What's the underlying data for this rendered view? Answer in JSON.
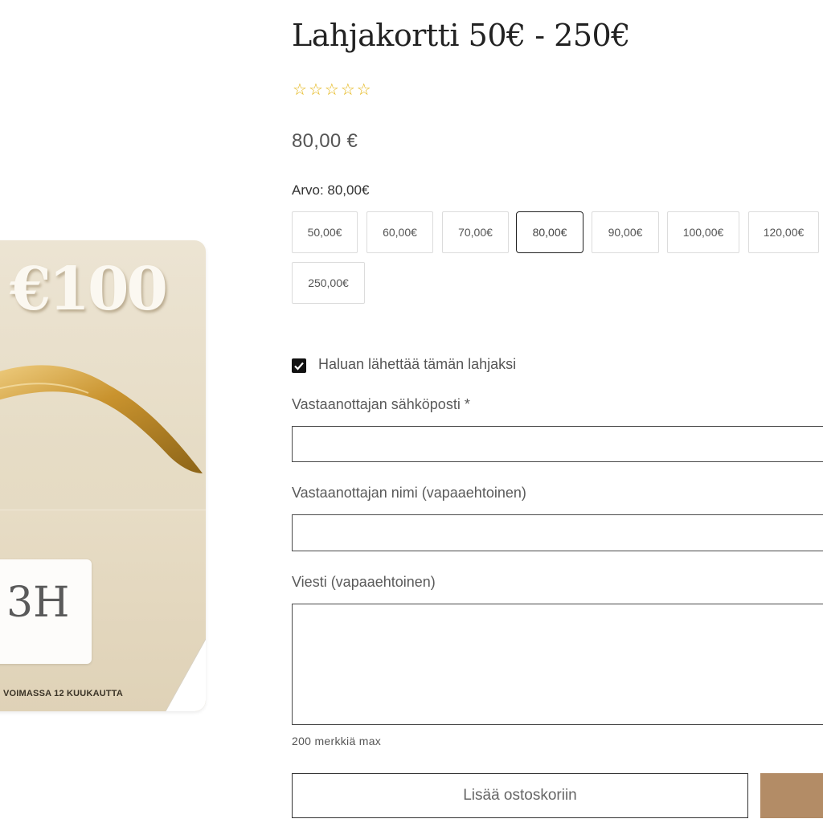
{
  "card": {
    "amount": "€100",
    "code": "3H",
    "validity": "VOIMASSA 12 KUUKAUTTA"
  },
  "product": {
    "title": "Lahjakortti 50€ - 250€",
    "rating": {
      "value": 0,
      "max": 5,
      "star_color": "#e3b20b"
    },
    "price": "80,00 €",
    "value_label": "Arvo: 80,00€",
    "options": [
      "50,00€",
      "60,00€",
      "70,00€",
      "80,00€",
      "90,00€",
      "100,00€",
      "120,00€",
      "250,00€"
    ],
    "selected_option": "80,00€"
  },
  "gift_form": {
    "send_as_gift_label": "Haluan lähettää tämän lahjaksi",
    "send_as_gift_checked": true,
    "recipient_email_label": "Vastaanottajan sähköposti *",
    "recipient_email_value": "",
    "recipient_name_label": "Vastaanottajan nimi (vapaaehtoinen)",
    "recipient_name_value": "",
    "message_label": "Viesti (vapaaehtoinen)",
    "message_value": "",
    "message_hint": "200 merkkiä max"
  },
  "actions": {
    "add_to_cart_label": "Lisää ostoskoriin",
    "buy_button_color": "#b38c66"
  }
}
